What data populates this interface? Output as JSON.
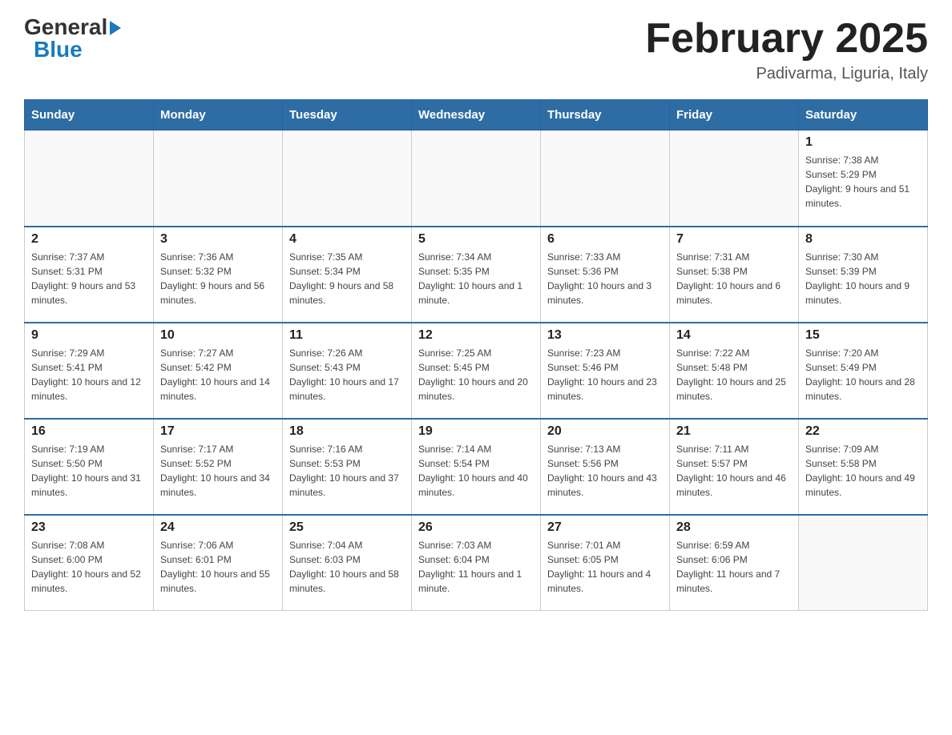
{
  "header": {
    "logo_general": "General",
    "logo_blue": "Blue",
    "title": "February 2025",
    "subtitle": "Padivarma, Liguria, Italy"
  },
  "days_of_week": [
    "Sunday",
    "Monday",
    "Tuesday",
    "Wednesday",
    "Thursday",
    "Friday",
    "Saturday"
  ],
  "weeks": [
    [
      {
        "day": "",
        "info": ""
      },
      {
        "day": "",
        "info": ""
      },
      {
        "day": "",
        "info": ""
      },
      {
        "day": "",
        "info": ""
      },
      {
        "day": "",
        "info": ""
      },
      {
        "day": "",
        "info": ""
      },
      {
        "day": "1",
        "info": "Sunrise: 7:38 AM\nSunset: 5:29 PM\nDaylight: 9 hours and 51 minutes."
      }
    ],
    [
      {
        "day": "2",
        "info": "Sunrise: 7:37 AM\nSunset: 5:31 PM\nDaylight: 9 hours and 53 minutes."
      },
      {
        "day": "3",
        "info": "Sunrise: 7:36 AM\nSunset: 5:32 PM\nDaylight: 9 hours and 56 minutes."
      },
      {
        "day": "4",
        "info": "Sunrise: 7:35 AM\nSunset: 5:34 PM\nDaylight: 9 hours and 58 minutes."
      },
      {
        "day": "5",
        "info": "Sunrise: 7:34 AM\nSunset: 5:35 PM\nDaylight: 10 hours and 1 minute."
      },
      {
        "day": "6",
        "info": "Sunrise: 7:33 AM\nSunset: 5:36 PM\nDaylight: 10 hours and 3 minutes."
      },
      {
        "day": "7",
        "info": "Sunrise: 7:31 AM\nSunset: 5:38 PM\nDaylight: 10 hours and 6 minutes."
      },
      {
        "day": "8",
        "info": "Sunrise: 7:30 AM\nSunset: 5:39 PM\nDaylight: 10 hours and 9 minutes."
      }
    ],
    [
      {
        "day": "9",
        "info": "Sunrise: 7:29 AM\nSunset: 5:41 PM\nDaylight: 10 hours and 12 minutes."
      },
      {
        "day": "10",
        "info": "Sunrise: 7:27 AM\nSunset: 5:42 PM\nDaylight: 10 hours and 14 minutes."
      },
      {
        "day": "11",
        "info": "Sunrise: 7:26 AM\nSunset: 5:43 PM\nDaylight: 10 hours and 17 minutes."
      },
      {
        "day": "12",
        "info": "Sunrise: 7:25 AM\nSunset: 5:45 PM\nDaylight: 10 hours and 20 minutes."
      },
      {
        "day": "13",
        "info": "Sunrise: 7:23 AM\nSunset: 5:46 PM\nDaylight: 10 hours and 23 minutes."
      },
      {
        "day": "14",
        "info": "Sunrise: 7:22 AM\nSunset: 5:48 PM\nDaylight: 10 hours and 25 minutes."
      },
      {
        "day": "15",
        "info": "Sunrise: 7:20 AM\nSunset: 5:49 PM\nDaylight: 10 hours and 28 minutes."
      }
    ],
    [
      {
        "day": "16",
        "info": "Sunrise: 7:19 AM\nSunset: 5:50 PM\nDaylight: 10 hours and 31 minutes."
      },
      {
        "day": "17",
        "info": "Sunrise: 7:17 AM\nSunset: 5:52 PM\nDaylight: 10 hours and 34 minutes."
      },
      {
        "day": "18",
        "info": "Sunrise: 7:16 AM\nSunset: 5:53 PM\nDaylight: 10 hours and 37 minutes."
      },
      {
        "day": "19",
        "info": "Sunrise: 7:14 AM\nSunset: 5:54 PM\nDaylight: 10 hours and 40 minutes."
      },
      {
        "day": "20",
        "info": "Sunrise: 7:13 AM\nSunset: 5:56 PM\nDaylight: 10 hours and 43 minutes."
      },
      {
        "day": "21",
        "info": "Sunrise: 7:11 AM\nSunset: 5:57 PM\nDaylight: 10 hours and 46 minutes."
      },
      {
        "day": "22",
        "info": "Sunrise: 7:09 AM\nSunset: 5:58 PM\nDaylight: 10 hours and 49 minutes."
      }
    ],
    [
      {
        "day": "23",
        "info": "Sunrise: 7:08 AM\nSunset: 6:00 PM\nDaylight: 10 hours and 52 minutes."
      },
      {
        "day": "24",
        "info": "Sunrise: 7:06 AM\nSunset: 6:01 PM\nDaylight: 10 hours and 55 minutes."
      },
      {
        "day": "25",
        "info": "Sunrise: 7:04 AM\nSunset: 6:03 PM\nDaylight: 10 hours and 58 minutes."
      },
      {
        "day": "26",
        "info": "Sunrise: 7:03 AM\nSunset: 6:04 PM\nDaylight: 11 hours and 1 minute."
      },
      {
        "day": "27",
        "info": "Sunrise: 7:01 AM\nSunset: 6:05 PM\nDaylight: 11 hours and 4 minutes."
      },
      {
        "day": "28",
        "info": "Sunrise: 6:59 AM\nSunset: 6:06 PM\nDaylight: 11 hours and 7 minutes."
      },
      {
        "day": "",
        "info": ""
      }
    ]
  ]
}
